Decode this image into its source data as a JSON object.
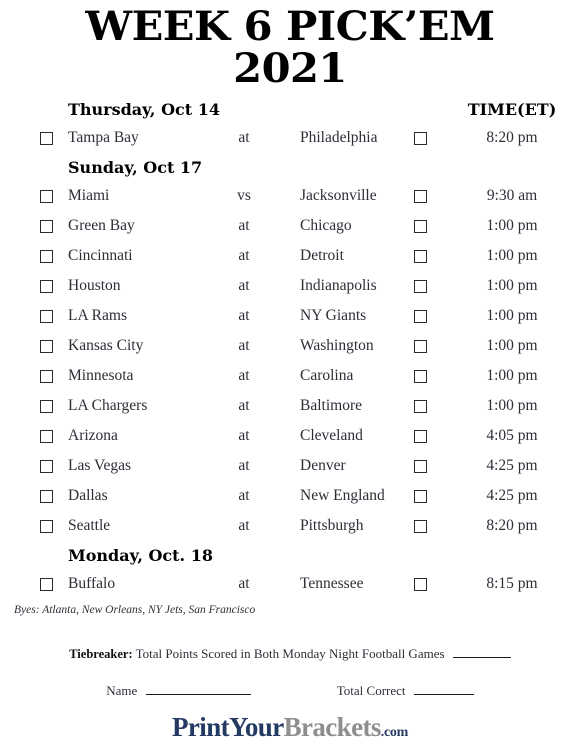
{
  "title": {
    "line1": "WEEK 6 PICK’EM",
    "line2": "2021"
  },
  "columns": {
    "time_header": "TIME(ET)"
  },
  "sections": [
    {
      "day": "Thursday, Oct 14",
      "games": [
        {
          "away": "Tampa Bay",
          "sep": "at",
          "home": "Philadelphia",
          "time": "8:20 pm"
        }
      ]
    },
    {
      "day": "Sunday, Oct 17",
      "games": [
        {
          "away": "Miami",
          "sep": "vs",
          "home": "Jacksonville",
          "time": "9:30 am"
        },
        {
          "away": "Green Bay",
          "sep": "at",
          "home": "Chicago",
          "time": "1:00 pm"
        },
        {
          "away": "Cincinnati",
          "sep": "at",
          "home": "Detroit",
          "time": "1:00 pm"
        },
        {
          "away": "Houston",
          "sep": "at",
          "home": "Indianapolis",
          "time": "1:00 pm"
        },
        {
          "away": "LA Rams",
          "sep": "at",
          "home": "NY Giants",
          "time": "1:00 pm"
        },
        {
          "away": "Kansas City",
          "sep": "at",
          "home": "Washington",
          "time": "1:00 pm"
        },
        {
          "away": "Minnesota",
          "sep": "at",
          "home": "Carolina",
          "time": "1:00 pm"
        },
        {
          "away": "LA Chargers",
          "sep": "at",
          "home": "Baltimore",
          "time": "1:00 pm"
        },
        {
          "away": "Arizona",
          "sep": "at",
          "home": "Cleveland",
          "time": "4:05 pm"
        },
        {
          "away": "Las Vegas",
          "sep": "at",
          "home": "Denver",
          "time": "4:25 pm"
        },
        {
          "away": "Dallas",
          "sep": "at",
          "home": "New England",
          "time": "4:25 pm"
        },
        {
          "away": "Seattle",
          "sep": "at",
          "home": "Pittsburgh",
          "time": "8:20 pm"
        }
      ]
    },
    {
      "day": "Monday, Oct. 18",
      "games": [
        {
          "away": "Buffalo",
          "sep": "at",
          "home": "Tennessee",
          "time": "8:15 pm"
        }
      ]
    }
  ],
  "byes": "Byes: Atlanta, New Orleans, NY Jets, San Francisco",
  "footer": {
    "tiebreaker_label": "Tiebreaker:",
    "tiebreaker_text": "Total Points Scored in Both Monday Night Football Games",
    "name_label": "Name",
    "total_correct_label": "Total Correct"
  },
  "logo": {
    "part1": "PrintYour",
    "part2": "Brackets",
    "part3": ".com",
    "color_navy": "#243a63",
    "color_gray": "#8e8e8e"
  }
}
